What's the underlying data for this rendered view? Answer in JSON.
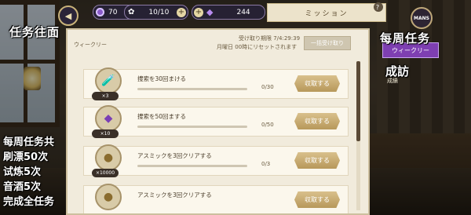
{
  "topbar": {
    "gems": "70",
    "stamina": "10/10",
    "crystals": "244",
    "mission_title": "ミッション",
    "help_label": "?",
    "avatar_label": "MANS"
  },
  "captions": {
    "top_left": "任务往面",
    "right_top": "每周任务",
    "right_mid": "成訪",
    "left_lines": [
      "每周任务共",
      "刷漂50次",
      "试炼5次",
      "音酒5次",
      "完成全任务"
    ]
  },
  "side_tabs": {
    "weekly": "ウィークリー",
    "achievement": "成績"
  },
  "panel": {
    "title": "ウィークリー",
    "deadline": "受け取り期限 7/4:29:39",
    "reset_note": "月曜日 00時にリセットされます",
    "claim_all_label": "一括受け取り"
  },
  "tasks": [
    {
      "name": "捜索を30回まける",
      "count": "0/30",
      "qty": "×3",
      "icon": "potion-icon",
      "progress": 0,
      "claim": "収取する"
    },
    {
      "name": "捜索を50回まする",
      "count": "0/50",
      "qty": "×10",
      "icon": "crystal-icon",
      "progress": 0,
      "claim": "収取する"
    },
    {
      "name": "アスミックを3回クリアする",
      "count": "0/3",
      "qty": "×10000",
      "icon": "coin-icon",
      "progress": 0,
      "claim": "収取する"
    },
    {
      "name": "アスミックを3回クリアする",
      "count": "",
      "qty": "",
      "icon": "coin-icon",
      "progress": 0,
      "claim": "収取する"
    }
  ]
}
